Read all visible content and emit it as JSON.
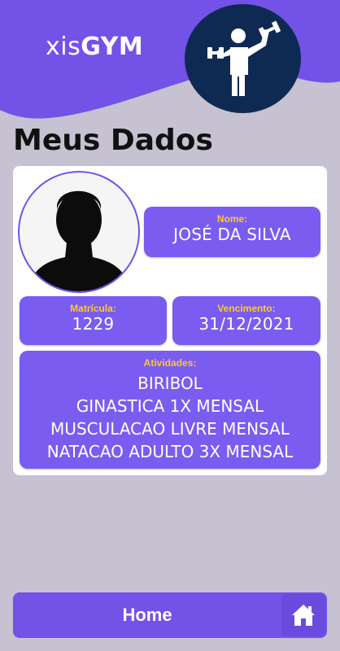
{
  "header": {
    "brand_light": "xis",
    "brand_bold": "GYM",
    "color_primary": "#7352e8",
    "logo_icon": "gym-dumbbell-icon"
  },
  "page_title": "Meus Dados",
  "profile": {
    "avatar_icon": "user-silhouette-icon",
    "nome_label": "Nome:",
    "nome": "JOSÉ DA SILVA",
    "matricula_label": "Matrícula:",
    "matricula": "1229",
    "vencimento_label": "Vencimento:",
    "vencimento": "31/12/2021",
    "atividades_label": "Atividades:",
    "atividades": [
      "BIRIBOL",
      "GINASTICA 1X MENSAL",
      "MUSCULACAO LIVRE MENSAL",
      "NATACAO ADULTO 3X MENSAL"
    ]
  },
  "bottom_nav": {
    "home_label": "Home",
    "home_icon": "home-icon"
  },
  "colors": {
    "background": "#c6c2d1",
    "accent": "#7352e8",
    "label_yellow": "#ffc928",
    "logo_circle": "#0f2a52"
  }
}
